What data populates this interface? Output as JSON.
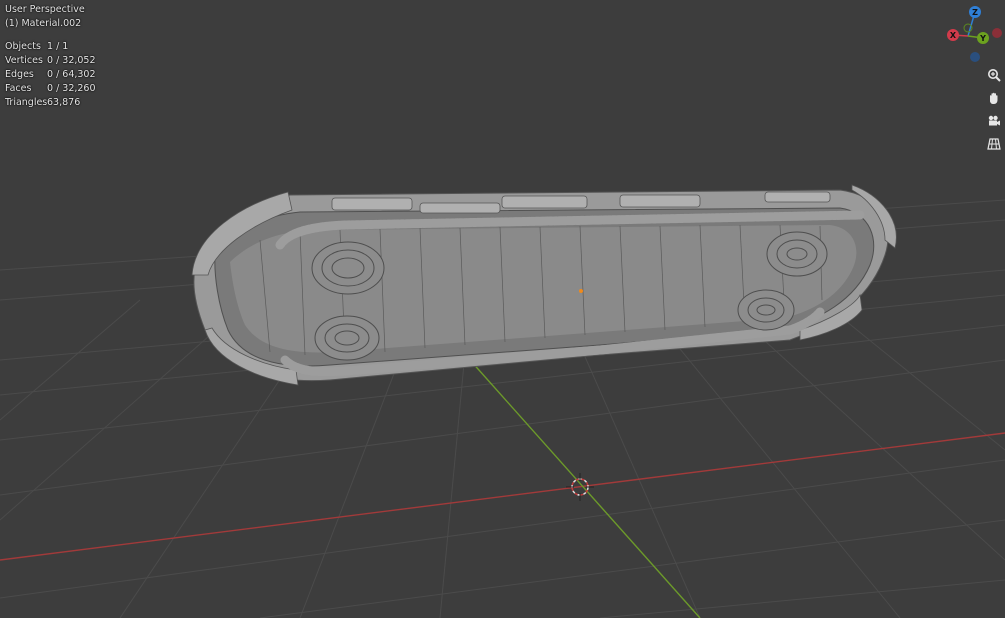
{
  "viewport": {
    "view_name": "User Perspective",
    "object_name": "(1) Material.002"
  },
  "stats": [
    {
      "label": "Objects",
      "value": "1 / 1"
    },
    {
      "label": "Vertices",
      "value": "0 / 32,052"
    },
    {
      "label": "Edges",
      "value": "0 / 64,302"
    },
    {
      "label": "Faces",
      "value": "0 / 32,260"
    },
    {
      "label": "Triangles",
      "value": "63,876"
    }
  ],
  "gizmo": {
    "axes": [
      {
        "label": "Z",
        "color": "#2f7fd6"
      },
      {
        "label": "Y",
        "color": "#6ca21f"
      },
      {
        "label": "X",
        "color": "#d23b4b"
      }
    ]
  },
  "nav_tools": [
    {
      "name": "zoom",
      "icon": "zoom-icon"
    },
    {
      "name": "pan",
      "icon": "hand-icon"
    },
    {
      "name": "camera",
      "icon": "camera-icon"
    },
    {
      "name": "perspective",
      "icon": "grid-perspective-icon"
    }
  ],
  "colors": {
    "background": "#3d3d3d",
    "grid": "#4a4a4a",
    "x_axis": "#a23a3a",
    "y_axis": "#6c9a2a",
    "mesh": "#8c8c8c"
  }
}
